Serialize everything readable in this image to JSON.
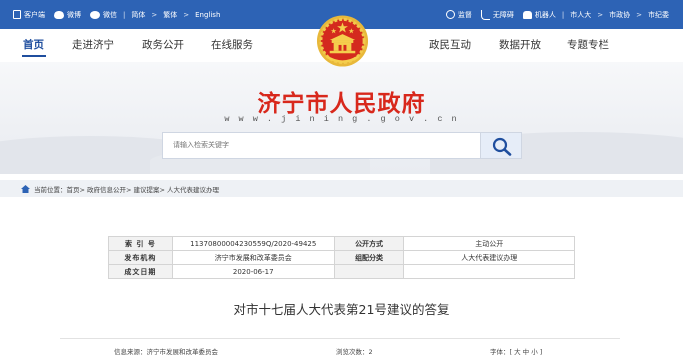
{
  "topbar": {
    "client": "客户端",
    "weibo": "微博",
    "wechat": "微信",
    "sep": "|",
    "lang_simplified": "简体",
    "arrow": ">",
    "lang_traditional": "繁体",
    "lang_english": "English",
    "supervise": "监督",
    "accessibility": "无障碍",
    "robot": "机器人",
    "npc": "市人大",
    "cppcc": "市政协",
    "discipline": "市纪委"
  },
  "nav": {
    "home": "首页",
    "about": "走进济宁",
    "affairs": "政务公开",
    "services": "在线服务",
    "interaction": "政民互动",
    "data": "数据开放",
    "special": "专题专栏"
  },
  "banner": {
    "title": "济宁市人民政府",
    "url": "w w w . j i n i n g . g o v . c n"
  },
  "search": {
    "placeholder": "请输入检索关键字"
  },
  "breadcrumb": {
    "text": "当前位置：首页> 政府信息公开> 建议提案> 人大代表建议办理"
  },
  "info": {
    "index_label": "索 引 号",
    "index_value": "11370800004230559Q/2020-49425",
    "public_mode_label": "公开方式",
    "public_mode_value": "主动公开",
    "publisher_label": "发布机构",
    "publisher_value": "济宁市发展和改革委员会",
    "category_label": "组配分类",
    "category_value": "人大代表建议办理",
    "date_label": "成文日期",
    "date_value": "2020-06-17"
  },
  "document": {
    "title": "对市十七届人大代表第21号建议的答复"
  },
  "meta": {
    "source": "信息来源：济宁市发展和改革委员会",
    "views": "浏览次数：2",
    "fontsize": "字体：[ 大 中 小 ]"
  },
  "colors": {
    "topbar": "#2d63b5",
    "accent": "#1f4e9e",
    "title_red": "#d8281c"
  }
}
